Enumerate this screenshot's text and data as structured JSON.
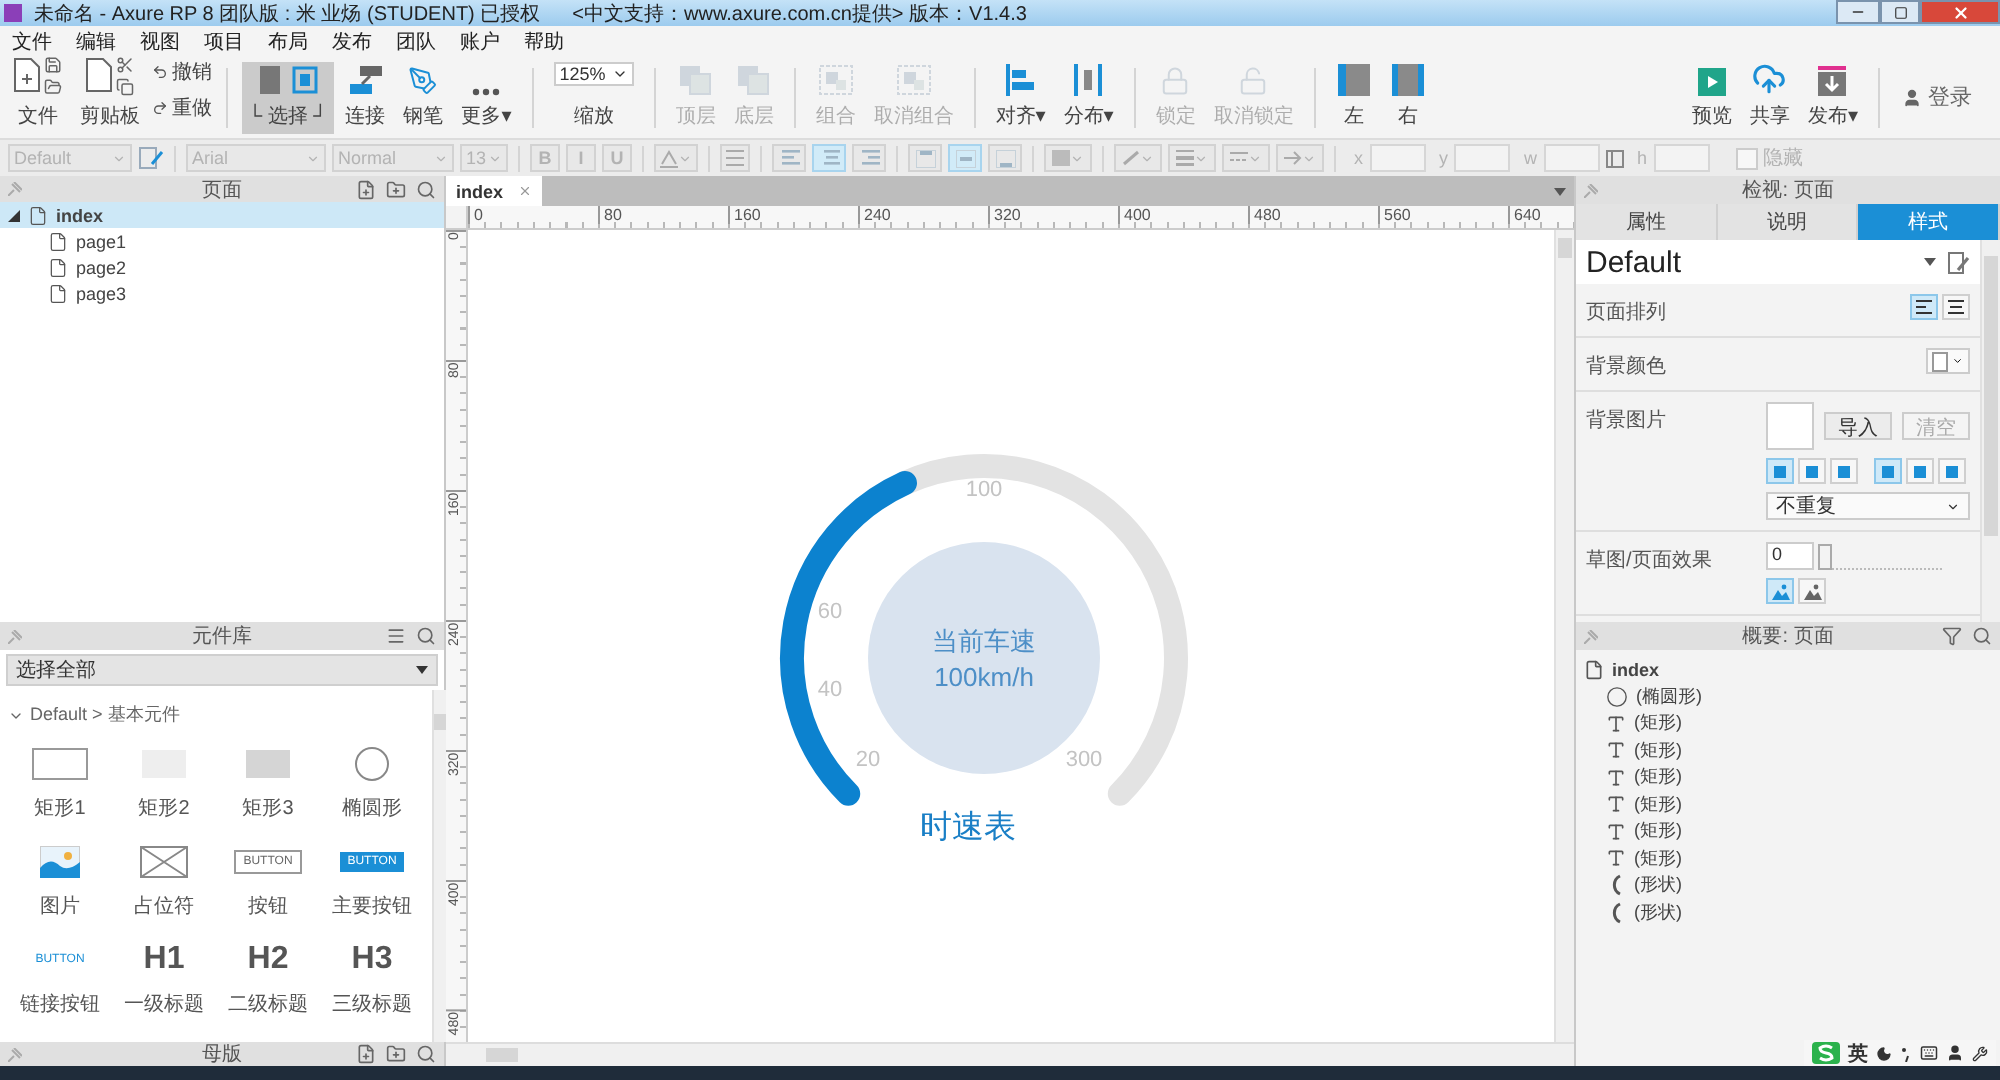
{
  "window": {
    "title": "未命名 - Axure RP 8 团队版 : 米 业炀 (STUDENT) 已授权",
    "notice": "<中文支持：www.axure.com.cn提供> 版本：V1.4.3"
  },
  "menu": [
    "文件",
    "编辑",
    "视图",
    "项目",
    "布局",
    "发布",
    "团队",
    "账户",
    "帮助"
  ],
  "toolbar_groups": [
    {
      "items": [
        {
          "kind": "file",
          "label": "文件",
          "disabled": false
        },
        {
          "kind": "clipboard",
          "label": "剪贴板",
          "disabled": false
        },
        {
          "kind": "history",
          "actions": [
            "撤销",
            "重做"
          ],
          "disabled": false
        }
      ]
    },
    {
      "items": [
        {
          "kind": "select",
          "label": "└ 选择 ┘",
          "disabled": false,
          "selected": true
        },
        {
          "kind": "connect",
          "label": "连接",
          "disabled": false,
          "selected": false
        },
        {
          "kind": "pen",
          "label": "钢笔",
          "disabled": false,
          "selected": false
        },
        {
          "kind": "more",
          "label": "更多▾",
          "disabled": false,
          "selected": false
        }
      ]
    },
    {
      "items": [
        {
          "kind": "zoom",
          "value": "125%",
          "label": "缩放",
          "disabled": false
        }
      ]
    },
    {
      "items": [
        {
          "kind": "front",
          "label": "顶层",
          "disabled": true
        },
        {
          "kind": "back",
          "label": "底层",
          "disabled": true
        }
      ]
    },
    {
      "items": [
        {
          "kind": "group",
          "label": "组合",
          "disabled": true
        },
        {
          "kind": "ungroup",
          "label": "取消组合",
          "disabled": true
        }
      ]
    },
    {
      "items": [
        {
          "kind": "align",
          "label": "对齐▾",
          "disabled": false
        },
        {
          "kind": "distribute",
          "label": "分布▾",
          "disabled": false
        }
      ]
    },
    {
      "items": [
        {
          "kind": "lock",
          "label": "锁定",
          "disabled": true
        },
        {
          "kind": "unlock",
          "label": "取消锁定",
          "disabled": true
        }
      ]
    },
    {
      "items": [
        {
          "kind": "left-panel",
          "label": "左",
          "disabled": false
        },
        {
          "kind": "right-panel",
          "label": "右",
          "disabled": false
        }
      ]
    }
  ],
  "publish_tools": [
    {
      "kind": "preview",
      "label": "预览",
      "disabled": false
    },
    {
      "kind": "share",
      "label": "共享",
      "disabled": false
    },
    {
      "kind": "publish",
      "label": "发布▾",
      "disabled": false
    }
  ],
  "account": {
    "label": "登录"
  },
  "format_bar": {
    "disabled": true,
    "groups": [
      [
        {
          "kind": "dropdown",
          "value": "Default"
        },
        {
          "kind": "style-icon"
        }
      ],
      [
        {
          "kind": "dropdown",
          "value": "Arial"
        },
        {
          "kind": "dropdown",
          "value": "Normal"
        },
        {
          "kind": "dropdown",
          "value": "13"
        }
      ],
      [
        {
          "kind": "text-style",
          "value": "B"
        },
        {
          "kind": "text-style",
          "value": "I"
        },
        {
          "kind": "text-style",
          "value": "U"
        }
      ],
      [
        {
          "kind": "font-color"
        }
      ],
      [
        {
          "kind": "bullets"
        }
      ],
      [
        {
          "kind": "align-left",
          "selected": false
        },
        {
          "kind": "align-center",
          "selected": true
        },
        {
          "kind": "align-right",
          "selected": false
        }
      ],
      [
        {
          "kind": "align-top",
          "selected": false
        },
        {
          "kind": "align-middle",
          "selected": true
        },
        {
          "kind": "align-bottom",
          "selected": false
        }
      ],
      [
        {
          "kind": "fill"
        }
      ],
      [
        {
          "kind": "line-color"
        },
        {
          "kind": "line-weight"
        },
        {
          "kind": "line-pattern"
        },
        {
          "kind": "arrow-style"
        }
      ],
      [
        {
          "kind": "coord",
          "label": "x"
        },
        {
          "kind": "coord",
          "label": "y"
        },
        {
          "kind": "coord",
          "label": "w"
        },
        {
          "kind": "lock-ratio"
        },
        {
          "kind": "coord",
          "label": "h"
        },
        {
          "kind": "checkbox",
          "label": "隐藏",
          "checked": false
        }
      ]
    ]
  },
  "pages": {
    "title": "页面",
    "tree": [
      {
        "label": "index",
        "selected": true,
        "expanded": true,
        "children": [
          {
            "label": "page1",
            "selected": false
          },
          {
            "label": "page2",
            "selected": false
          },
          {
            "label": "page3",
            "selected": false
          }
        ]
      }
    ]
  },
  "widgets": {
    "title": "元件库",
    "library": "选择全部",
    "section": "Default > 基本元件",
    "expanded": true,
    "items": [
      {
        "kind": "rect1",
        "label": "矩形1"
      },
      {
        "kind": "rect2",
        "label": "矩形2"
      },
      {
        "kind": "rect3",
        "label": "矩形3"
      },
      {
        "kind": "ellipse",
        "label": "椭圆形"
      },
      {
        "kind": "image",
        "label": "图片"
      },
      {
        "kind": "placeholder",
        "label": "占位符"
      },
      {
        "kind": "button",
        "preview": "BUTTON",
        "label": "按钮"
      },
      {
        "kind": "primary",
        "preview": "BUTTON",
        "label": "主要按钮"
      },
      {
        "kind": "link",
        "preview": "BUTTON",
        "label": "链接按钮"
      },
      {
        "kind": "heading",
        "preview": "H1",
        "label": "一级标题"
      },
      {
        "kind": "heading",
        "preview": "H2",
        "label": "二级标题"
      },
      {
        "kind": "heading",
        "preview": "H3",
        "label": "三级标题"
      }
    ]
  },
  "masters": {
    "title": "母版"
  },
  "canvas": {
    "tab": "index",
    "x_ruler": [
      "0",
      "80",
      "160",
      "240",
      "320",
      "400",
      "480",
      "560",
      "640"
    ],
    "y_ruler": [
      "0",
      "80",
      "160",
      "240",
      "320",
      "400",
      "480"
    ],
    "gauge": {
      "center": [
        "当前车速",
        "100km/h"
      ],
      "ticks": [
        "20",
        "40",
        "60",
        "100",
        "300"
      ],
      "title": "时速表"
    }
  },
  "inspector": {
    "title": "检视: 页面",
    "tabs": [
      {
        "label": "属性",
        "selected": false
      },
      {
        "label": "说明",
        "selected": false
      },
      {
        "label": "样式",
        "selected": true
      }
    ],
    "style": "Default",
    "rows": [
      {
        "kind": "arrange",
        "label": "页面排列",
        "options": [
          {
            "selected": true
          },
          {
            "selected": false
          }
        ]
      },
      {
        "kind": "color",
        "label": "背景颜色"
      },
      {
        "kind": "image",
        "label": "背景图片",
        "buttons": [
          {
            "label": "导入",
            "disabled": false
          },
          {
            "label": "清空",
            "disabled": true
          }
        ],
        "positions": [
          {
            "selected": true
          },
          {
            "selected": false
          },
          {
            "selected": false
          },
          {
            "selected": true
          },
          {
            "selected": false
          },
          {
            "selected": false
          }
        ],
        "repeat": "不重复"
      },
      {
        "kind": "sketch",
        "label": "草图/页面效果",
        "value": "0",
        "level": 0,
        "modes": [
          {
            "selected": true
          },
          {
            "selected": false
          }
        ]
      }
    ]
  },
  "outline": {
    "title": "概要: 页面",
    "tree": [
      {
        "label": "index",
        "children": [
          {
            "kind": "ellipse",
            "label": "(椭圆形)"
          },
          {
            "kind": "text",
            "label": "(矩形)"
          },
          {
            "kind": "text",
            "label": "(矩形)"
          },
          {
            "kind": "text",
            "label": "(矩形)"
          },
          {
            "kind": "text",
            "label": "(矩形)"
          },
          {
            "kind": "text",
            "label": "(矩形)"
          },
          {
            "kind": "text",
            "label": "(矩形)"
          },
          {
            "kind": "arc",
            "label": "(形状)"
          },
          {
            "kind": "arc",
            "label": "(形状)"
          }
        ]
      }
    ]
  },
  "ime_bar": {
    "language": "英"
  }
}
